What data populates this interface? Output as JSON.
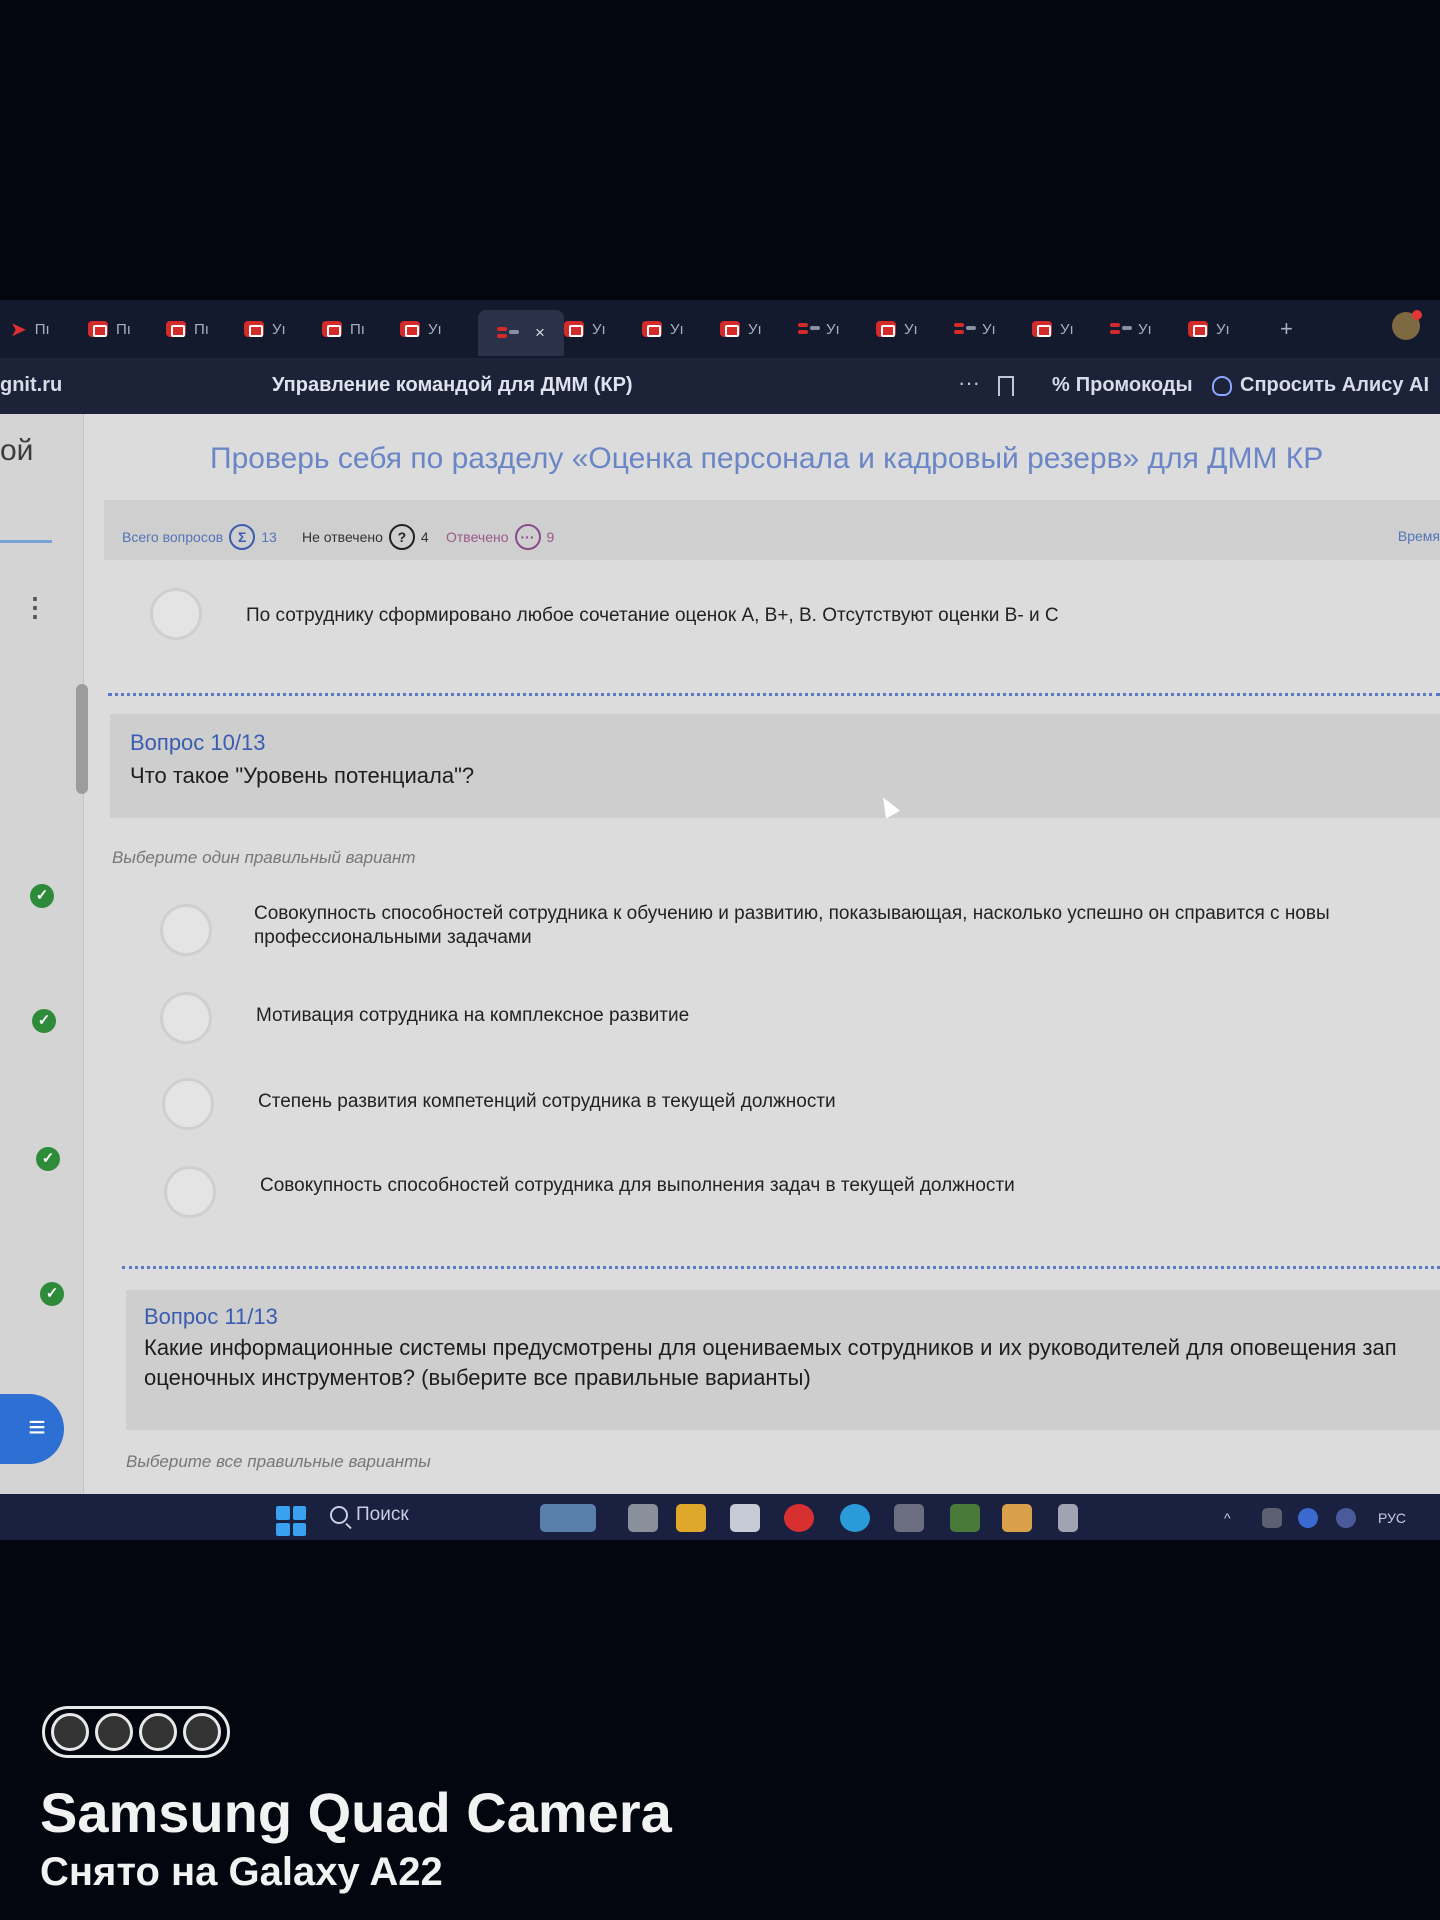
{
  "browser": {
    "tabs": [
      {
        "label": "Пı",
        "icon": "arrow"
      },
      {
        "label": "Пı",
        "icon": "brand"
      },
      {
        "label": "Пı",
        "icon": "brand"
      },
      {
        "label": "Уı",
        "icon": "brand"
      },
      {
        "label": "Пı",
        "icon": "brand"
      },
      {
        "label": "Уı",
        "icon": "brand"
      },
      {
        "label": "",
        "icon": "alt",
        "active": true
      },
      {
        "label": "Уı",
        "icon": "brand"
      },
      {
        "label": "Уı",
        "icon": "brand"
      },
      {
        "label": "Уı",
        "icon": "brand"
      },
      {
        "label": "Уı",
        "icon": "alt"
      },
      {
        "label": "Уı",
        "icon": "brand"
      },
      {
        "label": "Уı",
        "icon": "alt"
      },
      {
        "label": "Уı",
        "icon": "brand"
      },
      {
        "label": "Уı",
        "icon": "alt"
      },
      {
        "label": "Уı",
        "icon": "brand"
      }
    ],
    "tab_close": "×",
    "new_tab": "+",
    "domain": "gnit.ru",
    "page_title": "Управление командой для ДММ (КР)",
    "more": "···",
    "promo_label": "Промокоды",
    "alice_label": "Спросить Алису AI"
  },
  "sidebar": {
    "heading_fragment": "ой",
    "kebab": "⋮",
    "check": "✓",
    "fab": "≡"
  },
  "test": {
    "title": "Проверь себя по разделу «Оценка персонала и кадровый резерв» для ДММ КР",
    "stats": {
      "total_label": "Всего вопросов",
      "total_icon": "Σ",
      "total_value": "13",
      "unanswered_label": "Не отвечено",
      "unanswered_icon": "?",
      "unanswered_value": "4",
      "answered_label": "Отвечено",
      "answered_icon": "···",
      "answered_value": "9",
      "time_label": "Время"
    },
    "prev_option": "По сотруднику сформировано любое сочетание оценок А, В+, В. Отсутствуют оценки В- и С",
    "q10": {
      "number": "Вопрос 10/13",
      "text": "Что такое \"Уровень потенциала\"?",
      "hint": "Выберите один правильный вариант",
      "options": [
        "Совокупность способностей сотрудника к обучению и развитию, показывающая, насколько успешно он справится с новы",
        "профессиональными задачами",
        "Мотивация сотрудника на комплексное развитие",
        "Степень развития компетенций сотрудника в текущей должности",
        "Совокупность способностей сотрудника для выполнения задач в текущей должности"
      ]
    },
    "q11": {
      "number": "Вопрос 11/13",
      "line1": "Какие информационные системы предусмотрены для оцениваемых сотрудников и их руководителей для оповещения зап",
      "line2": "оценочных инструментов? (выберите все правильные варианты)",
      "hint": "Выберите все правильные варианты"
    }
  },
  "taskbar": {
    "search_label": "Поиск",
    "lang": "РУС"
  },
  "watermark": {
    "title": "Samsung Quad Camera",
    "subtitle": "Снято на Galaxy A22"
  }
}
